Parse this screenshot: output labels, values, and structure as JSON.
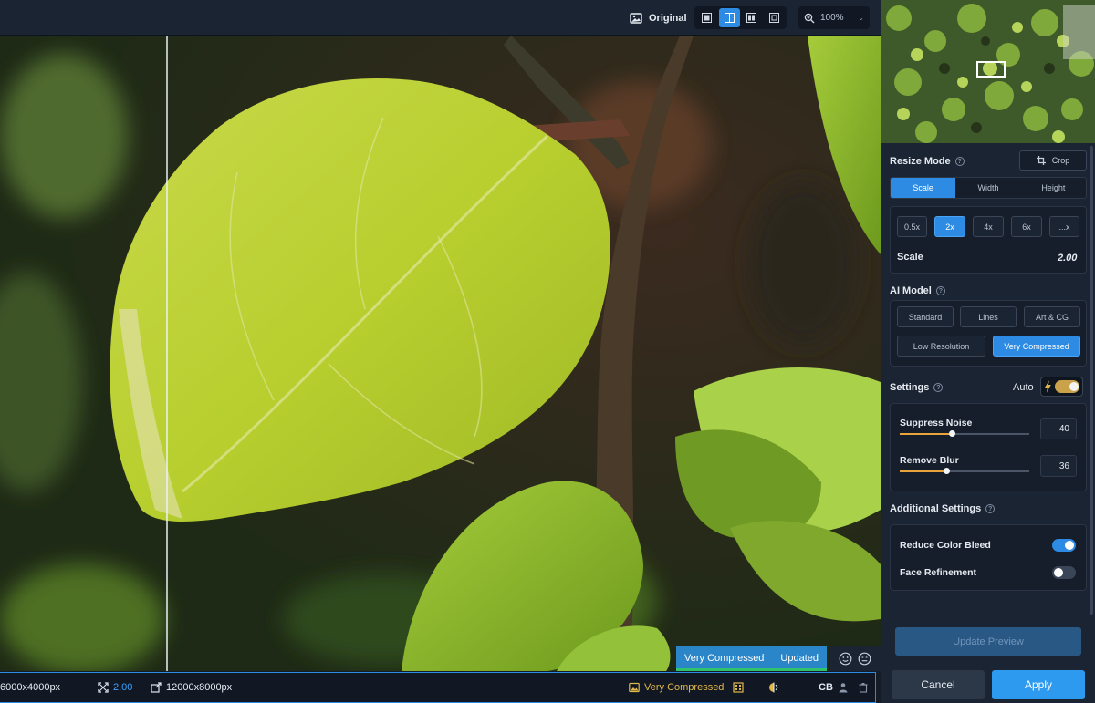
{
  "toolbar": {
    "original_label": "Original",
    "zoom_value": "100%",
    "view_modes": [
      "single-view",
      "split-view",
      "side-by-side-view",
      "grid-view"
    ],
    "active_view": "split-view"
  },
  "canvas": {
    "model_status": "Very Compressed",
    "model_status_state": "Updated"
  },
  "statusbar": {
    "input_size": "6000x4000px",
    "scale": "2.00",
    "output_size": "12000x8000px",
    "model": "Very Compressed",
    "cb": "CB"
  },
  "panel": {
    "resize_mode_title": "Resize Mode",
    "crop_label": "Crop",
    "mode_tabs": [
      "Scale",
      "Width",
      "Height"
    ],
    "active_mode": "Scale",
    "scale_presets": [
      "0.5x",
      "2x",
      "4x",
      "6x",
      "...x"
    ],
    "active_preset": "2x",
    "scale_label": "Scale",
    "scale_value": "2.00",
    "ai_model_title": "AI Model",
    "models_row1": [
      "Standard",
      "Lines",
      "Art & CG"
    ],
    "models_row2": [
      "Low Resolution",
      "Very Compressed"
    ],
    "active_model": "Very Compressed",
    "settings_title": "Settings",
    "auto_label": "Auto",
    "auto_on": true,
    "suppress_noise_label": "Suppress Noise",
    "suppress_noise_value": "40",
    "suppress_noise_level": 40,
    "remove_blur_label": "Remove Blur",
    "remove_blur_value": "36",
    "remove_blur_level": 36,
    "additional_title": "Additional Settings",
    "reduce_color_bleed_label": "Reduce Color Bleed",
    "reduce_color_bleed_on": true,
    "face_refinement_label": "Face Refinement",
    "face_refinement_on": false,
    "update_preview_label": "Update Preview",
    "cancel_label": "Cancel",
    "apply_label": "Apply"
  },
  "colors": {
    "accent": "#2d8be3",
    "panel_bg": "#1b2433",
    "slider_fill": "#e8a33a",
    "auto_toggle": "#c9a24a",
    "status_green": "#2fc46b"
  }
}
